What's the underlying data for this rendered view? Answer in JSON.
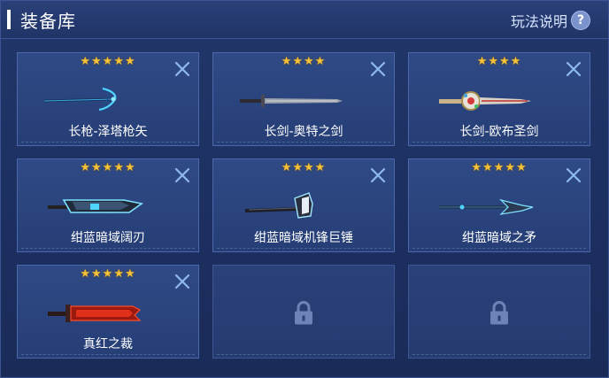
{
  "header": {
    "title": "装备库",
    "help_label": "玩法说明",
    "help_icon": "question-icon"
  },
  "colors": {
    "star": "#f3c23a",
    "close": "#8fb8f0",
    "panel": "#22376a"
  },
  "cards": [
    {
      "name": "长枪-泽塔枪矢",
      "stars": "★★★★★",
      "weapon": "spear-bow-icon"
    },
    {
      "name": "长剑-奥特之剑",
      "stars": "★★★★",
      "weapon": "long-sword-icon"
    },
    {
      "name": "长剑-欧布圣剑",
      "stars": "★★★★",
      "weapon": "holy-sword-icon"
    },
    {
      "name": "绀蓝暗域阔刃",
      "stars": "★★★★★",
      "weapon": "broad-blade-icon"
    },
    {
      "name": "绀蓝暗域机锋巨锤",
      "stars": "★★★★",
      "weapon": "giant-hammer-icon"
    },
    {
      "name": "绀蓝暗域之矛",
      "stars": "★★★★★",
      "weapon": "spear-icon"
    },
    {
      "name": "真红之裁",
      "stars": "★★★★★",
      "weapon": "crimson-sword-icon"
    }
  ],
  "locked_slots": 2
}
